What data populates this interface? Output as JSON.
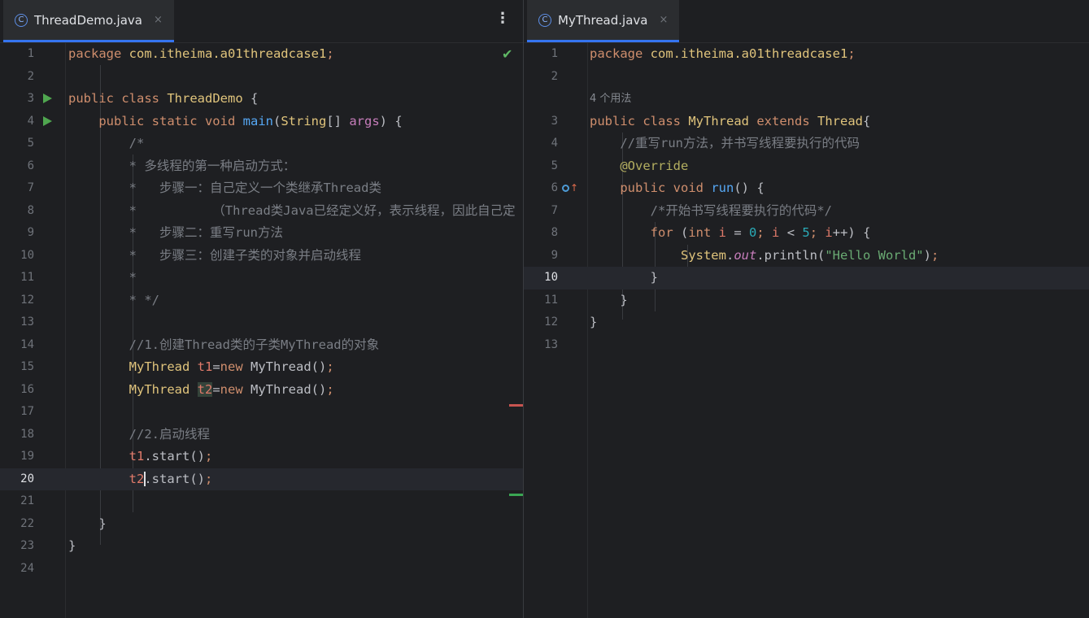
{
  "left_pane": {
    "tab": {
      "icon": "class-icon",
      "icon_letter": "C",
      "label": "ThreadDemo.java",
      "close": "×"
    },
    "menu_glyph": "⋮",
    "check_glyph": "✔",
    "lines": [
      {
        "n": "1",
        "text": "package com.itheima.a01threadcase1;"
      },
      {
        "n": "2",
        "text": ""
      },
      {
        "n": "3",
        "text": "public class ThreadDemo {"
      },
      {
        "n": "4",
        "text": "    public static void main(String[] args) {"
      },
      {
        "n": "5",
        "text": "        /*"
      },
      {
        "n": "6",
        "text": "        * 多线程的第一种启动方式："
      },
      {
        "n": "7",
        "text": "        *   步骤一：自己定义一个类继承Thread类"
      },
      {
        "n": "8",
        "text": "        *          （Thread类Java已经定义好，表示线程，因此自己定"
      },
      {
        "n": "9",
        "text": "        *   步骤二：重写run方法"
      },
      {
        "n": "10",
        "text": "        *   步骤三：创建子类的对象并启动线程"
      },
      {
        "n": "11",
        "text": "        *"
      },
      {
        "n": "12",
        "text": "        * */"
      },
      {
        "n": "13",
        "text": ""
      },
      {
        "n": "14",
        "text": "        //1.创建Thread类的子类MyThread的对象"
      },
      {
        "n": "15",
        "text": "        MyThread t1=new MyThread();"
      },
      {
        "n": "16",
        "text": "        MyThread t2=new MyThread();"
      },
      {
        "n": "17",
        "text": ""
      },
      {
        "n": "18",
        "text": "        //2.启动线程"
      },
      {
        "n": "19",
        "text": "        t1.start();"
      },
      {
        "n": "20",
        "text": "        t2.start();"
      },
      {
        "n": "21",
        "text": ""
      },
      {
        "n": "22",
        "text": "    }"
      },
      {
        "n": "23",
        "text": "}"
      },
      {
        "n": "24",
        "text": ""
      }
    ]
  },
  "right_pane": {
    "tab": {
      "icon": "class-icon",
      "icon_letter": "C",
      "label": "MyThread.java",
      "close": "×"
    },
    "usage_hint": "4 个用法",
    "override_arrow": "↑",
    "lines": [
      {
        "n": "1",
        "text": "package com.itheima.a01threadcase1;"
      },
      {
        "n": "2",
        "text": ""
      },
      {
        "n": "3",
        "text": "public class MyThread extends Thread{"
      },
      {
        "n": "4",
        "text": "    //重写run方法，并书写线程要执行的代码"
      },
      {
        "n": "5",
        "text": "    @Override"
      },
      {
        "n": "6",
        "text": "    public void run() {"
      },
      {
        "n": "7",
        "text": "        /*开始书写线程要执行的代码*/"
      },
      {
        "n": "8",
        "text": "        for (int i = 0; i < 5; i++) {"
      },
      {
        "n": "9",
        "text": "            System.out.println(\"Hello World\");"
      },
      {
        "n": "10",
        "text": "        }"
      },
      {
        "n": "11",
        "text": "    }"
      },
      {
        "n": "12",
        "text": "}"
      },
      {
        "n": "13",
        "text": ""
      }
    ]
  },
  "colors": {
    "keyword": "#cf8e6d",
    "class_name": "#e0c47c",
    "method": "#56a8f5",
    "string": "#6aab73",
    "number": "#2aacb8",
    "comment": "#7a7e85",
    "annotation": "#b3ae60",
    "accent": "#3574f0",
    "background": "#1e1f22"
  }
}
